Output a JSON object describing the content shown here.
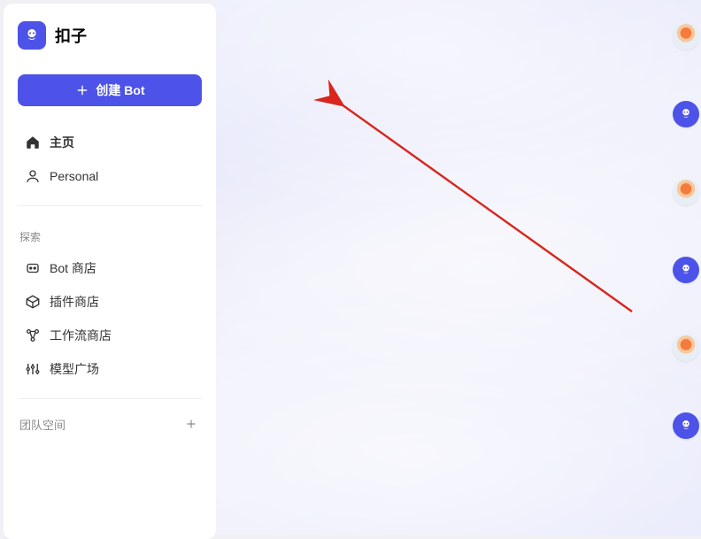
{
  "brand": {
    "name": "扣子"
  },
  "sidebar": {
    "create_label": "创建 Bot",
    "nav": [
      {
        "label": "主页"
      },
      {
        "label": "Personal"
      }
    ],
    "explore_label": "探索",
    "explore": [
      {
        "label": "Bot 商店"
      },
      {
        "label": "插件商店"
      },
      {
        "label": "工作流商店"
      },
      {
        "label": "模型广场"
      }
    ],
    "team_label": "团队空间"
  },
  "colors": {
    "accent": "#4d53e8"
  }
}
